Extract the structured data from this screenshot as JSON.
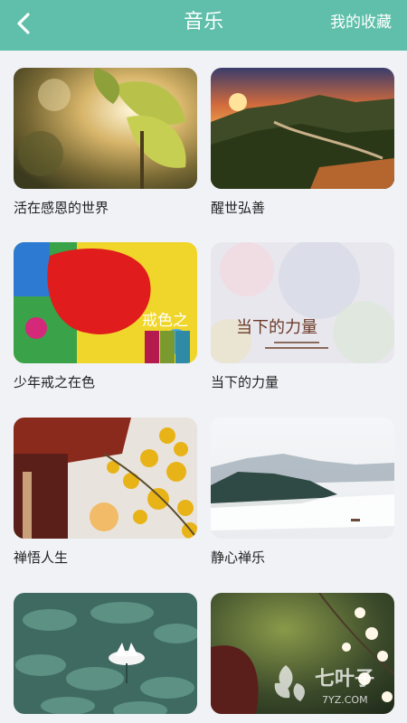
{
  "header": {
    "title": "音乐",
    "favorites_label": "我的收藏",
    "background_color": "#5fbfaa"
  },
  "cards": [
    {
      "label": "活在感恩的世界"
    },
    {
      "label": "醒世弘善"
    },
    {
      "label": "少年戒之在色",
      "thumb_text": "戒色之"
    },
    {
      "label": "当下的力量",
      "thumb_text": "当下的力量"
    },
    {
      "label": "禅悟人生"
    },
    {
      "label": "静心禅乐"
    },
    {
      "label": ""
    },
    {
      "label": ""
    }
  ],
  "watermark": {
    "main": "七叶子",
    "sub": "7YZ.COM"
  }
}
